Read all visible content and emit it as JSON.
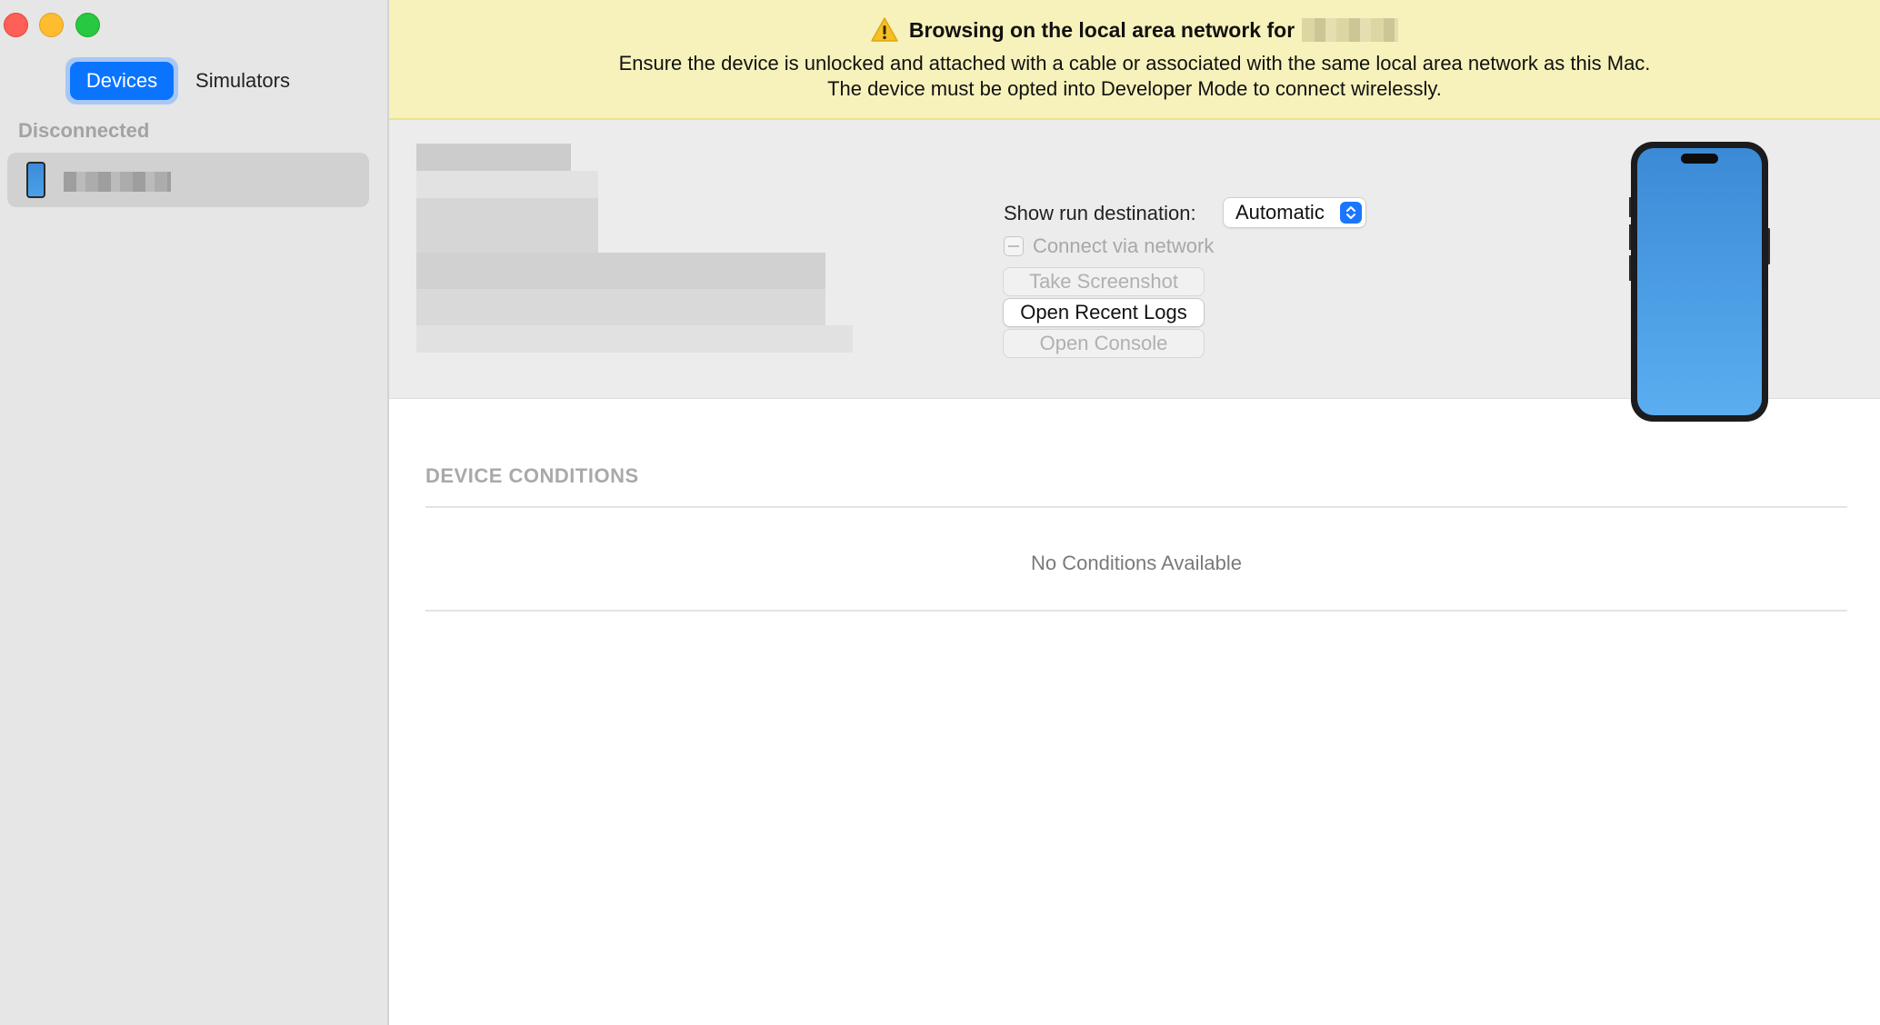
{
  "sidebar": {
    "tabs": [
      {
        "label": "Devices",
        "selected": true
      },
      {
        "label": "Simulators",
        "selected": false
      }
    ],
    "section_header": "Disconnected",
    "devices": [
      {
        "icon": "iphone-icon"
      }
    ]
  },
  "banner": {
    "title": "Browsing on the local area network for",
    "message_line1": "Ensure the device is unlocked and attached with a cable or associated with the same local area network as this Mac.",
    "message_line2": "The device must be opted into Developer Mode to connect wirelessly.",
    "icon": "warning-icon",
    "background_color": "#f7f2bb"
  },
  "device_panel": {
    "run_destination_label": "Show run destination:",
    "run_destination_value": "Automatic",
    "connect_via_network_label": "Connect via network",
    "take_screenshot_label": "Take Screenshot",
    "open_recent_logs_label": "Open Recent Logs",
    "open_console_label": "Open Console"
  },
  "conditions": {
    "header": "DEVICE CONDITIONS",
    "empty_text": "No Conditions Available"
  },
  "colors": {
    "accent": "#0b74ff",
    "sidebar_bg": "#e6e6e6"
  }
}
